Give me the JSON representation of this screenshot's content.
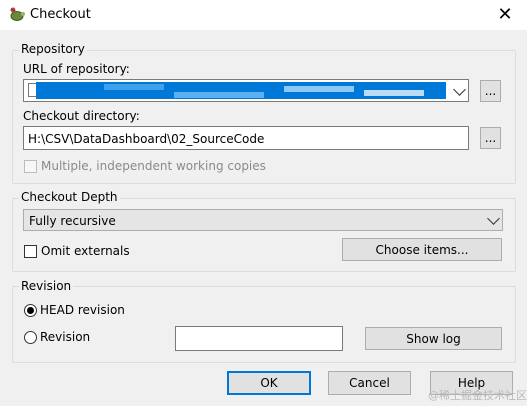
{
  "window": {
    "title": "Checkout",
    "close_glyph": "✕",
    "icon": "tortoise-icon"
  },
  "repository": {
    "group_label": "Repository",
    "url_label": "URL of repository:",
    "url_value": "",
    "browse_url_label": "...",
    "dir_label": "Checkout directory:",
    "dir_value": "H:\\CSV\\DataDashboard\\02_SourceCode",
    "browse_dir_label": "...",
    "multiple_copies_label": "Multiple, independent working copies"
  },
  "depth": {
    "group_label": "Checkout Depth",
    "selected": "Fully recursive",
    "omit_externals_label": "Omit externals",
    "choose_items_label": "Choose items..."
  },
  "revision": {
    "group_label": "Revision",
    "head_label": "HEAD revision",
    "revision_label": "Revision",
    "revision_value": "",
    "show_log_label": "Show log"
  },
  "buttons": {
    "ok": "OK",
    "cancel": "Cancel",
    "help": "Help"
  },
  "watermark": "@稀土掘金技术社区",
  "colors": {
    "accent": "#0078d7",
    "background": "#f0f0f0"
  }
}
